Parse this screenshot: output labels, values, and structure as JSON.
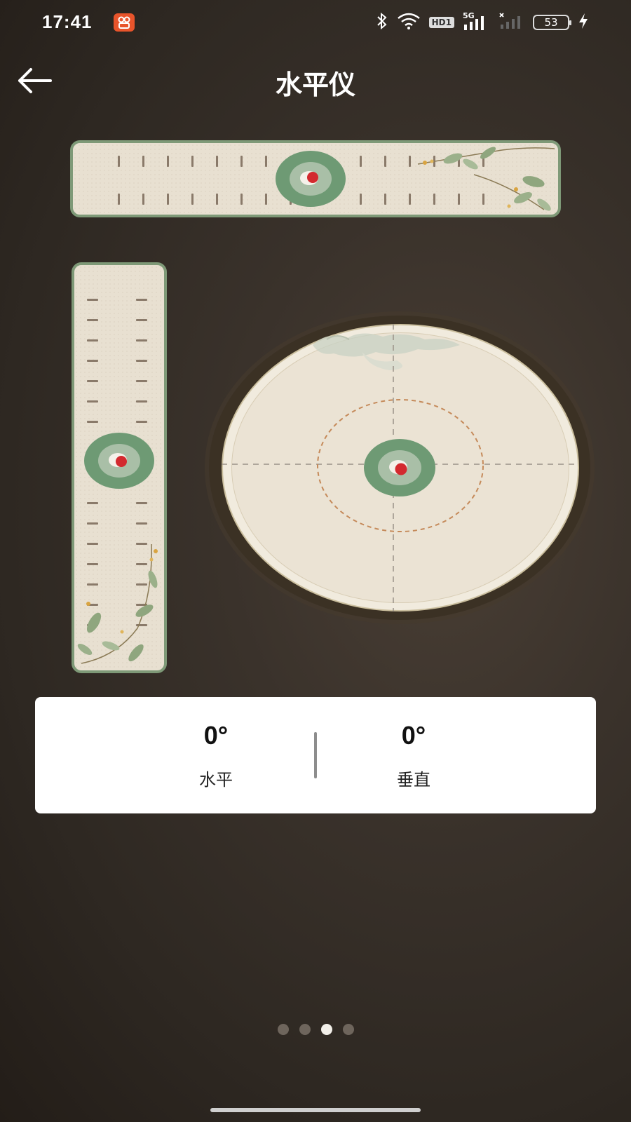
{
  "status_bar": {
    "time": "17:41",
    "app_badge_icon": "camera-app-icon",
    "bluetooth_icon": "bluetooth-icon",
    "wifi_icon": "wifi-icon",
    "hd_label": "HD1",
    "signal_label": "5G",
    "battery_level": "53",
    "charging_icon": "lightning-icon"
  },
  "header": {
    "back_icon": "arrow-left-icon",
    "title": "水平仪"
  },
  "levels": {
    "horizontal_tube": {
      "bubble_offset": 0
    },
    "vertical_tube": {
      "bubble_offset": 0
    },
    "circular": {
      "bubble_offset_x": 0,
      "bubble_offset_y": 0
    }
  },
  "readout": {
    "horizontal_value": "0°",
    "horizontal_label": "水平",
    "vertical_value": "0°",
    "vertical_label": "垂直"
  },
  "pager": {
    "count": 4,
    "active_index": 2
  },
  "colors": {
    "bubble_green": "#6e9a74",
    "bubble_light": "#a9bfa7",
    "bubble_red": "#d32a2f",
    "tube_border": "#7e9977",
    "card_background": "#ffffff"
  }
}
